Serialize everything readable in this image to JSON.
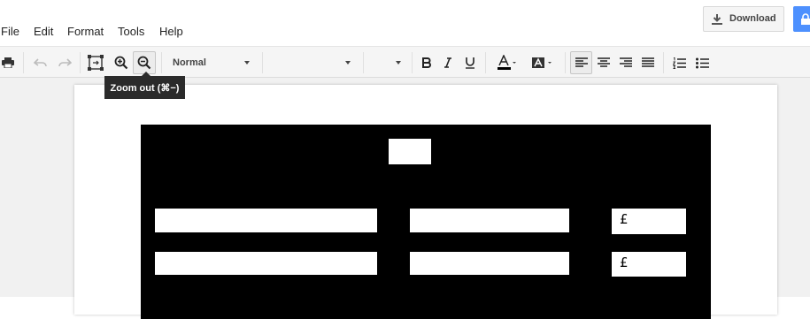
{
  "header": {
    "download_label": "Download",
    "download_icon": "download-icon",
    "share_icon": "lock-icon",
    "share_color": "#4d90fe"
  },
  "menu": {
    "items": [
      "File",
      "Edit",
      "Format",
      "Tools",
      "Help"
    ]
  },
  "toolbar": {
    "paragraph_style": "Normal",
    "font_family": "",
    "font_size": "",
    "tooltip": "Zoom out (⌘−)"
  },
  "document": {
    "currency_symbol": "£"
  }
}
